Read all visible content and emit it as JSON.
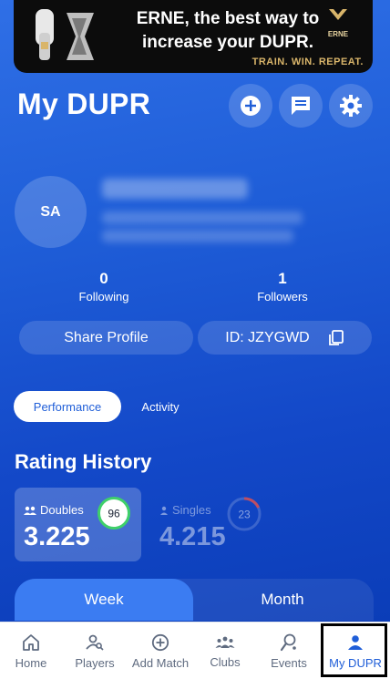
{
  "ad": {
    "headline_line1": "ERNE, the best way to",
    "headline_line2": "increase your DUPR.",
    "tagline": "TRAIN. WIN. REPEAT.",
    "logo_text": "ERNE"
  },
  "header": {
    "title": "My DUPR",
    "icons": [
      "add-icon",
      "chat-icon",
      "settings-icon"
    ]
  },
  "profile": {
    "initials": "SA",
    "following_count": "0",
    "following_label": "Following",
    "followers_count": "1",
    "followers_label": "Followers",
    "share_label": "Share Profile",
    "id_label": "ID: JZYGWD"
  },
  "tabs": {
    "performance": "Performance",
    "activity": "Activity"
  },
  "rating": {
    "section_title": "Rating History",
    "doubles_label": "Doubles",
    "doubles_value": "3.225",
    "doubles_reliability": "96",
    "singles_label": "Singles",
    "singles_value": "4.215",
    "singles_reliability": "23"
  },
  "timeframe": {
    "week": "Week",
    "month": "Month"
  },
  "nav": {
    "items": [
      {
        "label": "Home",
        "icon": "home-icon"
      },
      {
        "label": "Players",
        "icon": "players-icon"
      },
      {
        "label": "Add Match",
        "icon": "add-match-icon"
      },
      {
        "label": "Clubs",
        "icon": "clubs-icon"
      },
      {
        "label": "Events",
        "icon": "events-icon"
      },
      {
        "label": "My DUPR",
        "icon": "my-dupr-icon"
      }
    ],
    "active": "My DUPR"
  },
  "colors": {
    "brand_blue": "#1f5ed8",
    "ring_green": "#3fd06a",
    "ring_red": "#e04848",
    "ad_gold": "#d9b56a"
  }
}
